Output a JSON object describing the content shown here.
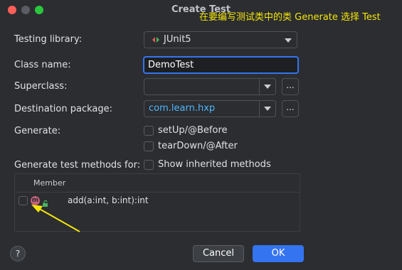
{
  "window": {
    "title": "Create Test"
  },
  "annotation": {
    "text": "在要编写测试类中的类 Generate 选择 Test"
  },
  "form": {
    "testing_library_label": "Testing library:",
    "testing_library_value": "JUnit5",
    "class_name_label": "Class name:",
    "class_name_value": "DemoTest",
    "superclass_label": "Superclass:",
    "superclass_value": "",
    "destination_package_label": "Destination package:",
    "destination_package_value": "com.learn.hxp",
    "browse_label": "...",
    "generate_label": "Generate:",
    "setup_label": "setUp/@Before",
    "teardown_label": "tearDown/@After",
    "generate_methods_label": "Generate test methods for:",
    "show_inherited_label": "Show inherited methods"
  },
  "members_table": {
    "header": "Member",
    "rows": [
      {
        "badge": "m",
        "signature": "add(a:int, b:int):int"
      }
    ]
  },
  "buttons": {
    "help": "?",
    "cancel": "Cancel",
    "ok": "OK"
  },
  "colors": {
    "background": "#2b2d30",
    "accent": "#3574f0",
    "link_text": "#4fb6ff",
    "annotation": "#f5e60a",
    "method_badge": "#c2607a"
  },
  "icons": [
    "junit-icon",
    "method-badge-icon",
    "lock-icon",
    "chevron-down-icon",
    "annotation-arrow-icon"
  ]
}
